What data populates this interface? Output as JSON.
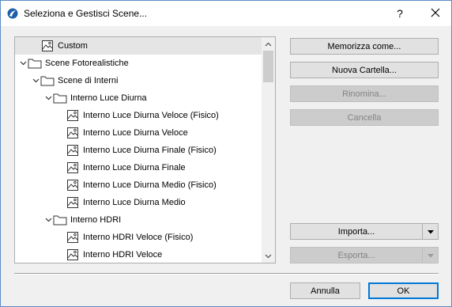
{
  "window": {
    "title": "Seleziona e Gestisci Scene...",
    "help_label": "?"
  },
  "tree": {
    "items": [
      {
        "label": "Custom",
        "type": "scene",
        "selected": true
      },
      {
        "label": "Scene Fotorealistiche",
        "type": "folder",
        "expanded": true
      },
      {
        "label": "Scene di Interni",
        "type": "folder",
        "expanded": true
      },
      {
        "label": "Interno Luce Diurna",
        "type": "folder",
        "expanded": true
      },
      {
        "label": "Interno Luce Diurna Veloce (Fisico)",
        "type": "scene"
      },
      {
        "label": "Interno Luce Diurna Veloce",
        "type": "scene"
      },
      {
        "label": "Interno Luce Diurna Finale (Fisico)",
        "type": "scene"
      },
      {
        "label": "Interno Luce Diurna Finale",
        "type": "scene"
      },
      {
        "label": "Interno Luce Diurna Medio (Fisico)",
        "type": "scene"
      },
      {
        "label": "Interno Luce Diurna Medio",
        "type": "scene"
      },
      {
        "label": "Interno HDRI",
        "type": "folder",
        "expanded": true
      },
      {
        "label": "Interno HDRI Veloce (Fisico)",
        "type": "scene"
      },
      {
        "label": "Interno HDRI Veloce",
        "type": "scene"
      }
    ]
  },
  "buttons": {
    "save_as": "Memorizza come...",
    "new_folder": "Nuova Cartella...",
    "rename": "Rinomina...",
    "delete": "Cancella",
    "import": "Importa...",
    "export": "Esporta...",
    "cancel": "Annulla",
    "ok": "OK"
  },
  "icons": {
    "app": "archicad-icon",
    "folder": "folder-icon",
    "scene": "scene-image-icon",
    "expand": "chevron-down-icon"
  },
  "colors": {
    "accent": "#0078d7",
    "selected_row": "#e5e5e5",
    "disabled_text": "#838383"
  }
}
